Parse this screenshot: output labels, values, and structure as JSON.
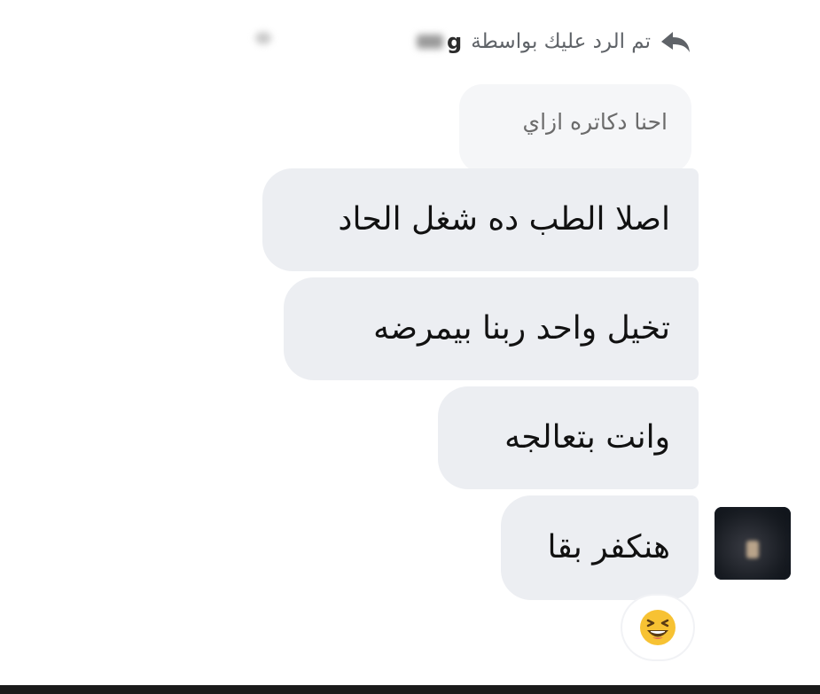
{
  "reply_header": {
    "label": "تم الرد عليك بواسطة",
    "replier_name_visible": "g"
  },
  "quoted_message": "احنا دكاتره ازاي",
  "messages": [
    "اصلا الطب ده شغل الحاد",
    "تخيل واحد ربنا بيمرضه",
    "وانت بتعالجه",
    "هنكفر بقا"
  ],
  "reaction": {
    "icon": "laughing-squint-emoji",
    "color": "#f7c233"
  },
  "icons": {
    "reply": "reply-arrow-icon"
  },
  "colors": {
    "bubble": "#eceef2",
    "quoted_bubble": "#f5f6f8",
    "header_text": "#5f6368"
  }
}
